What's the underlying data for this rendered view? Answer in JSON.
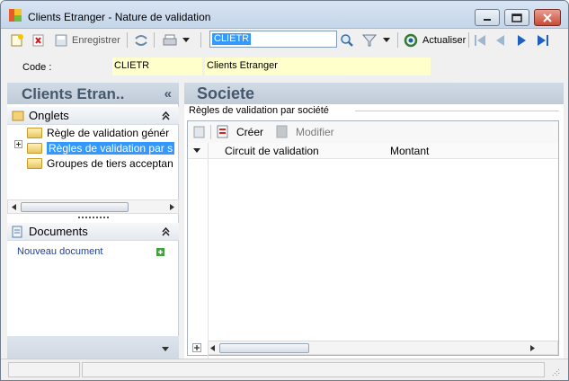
{
  "window": {
    "title": "Clients Etranger -  Nature de validation",
    "icon": "app-icon"
  },
  "toolbar": {
    "register_label": "Enregistrer",
    "search_value": "CLIETR",
    "refresh_label": "Actualiser"
  },
  "header": {
    "code_label": "Code :",
    "code_value": "CLIETR",
    "name_value": "Clients Etranger"
  },
  "left_panel": {
    "title": "Clients Etran..",
    "collapse_glyph": "«",
    "tabs_section": {
      "label": "Onglets",
      "items": [
        {
          "label": "Règle de validation génér",
          "selected": false
        },
        {
          "label": "Règles de validation par s",
          "selected": true
        },
        {
          "label": "Groupes de tiers acceptan",
          "selected": false
        }
      ]
    },
    "documents_section": {
      "label": "Documents",
      "new_document": "Nouveau document"
    }
  },
  "right_panel": {
    "title": "Societe",
    "group_label": "Règles de validation par société",
    "create_label": "Créer",
    "modify_label": "Modifier",
    "columns": [
      "Circuit de validation",
      "Montant"
    ]
  },
  "colors": {
    "accent": "#3399ff",
    "field_bg": "#ffffcc",
    "panel_header": "#c9d4e1"
  }
}
